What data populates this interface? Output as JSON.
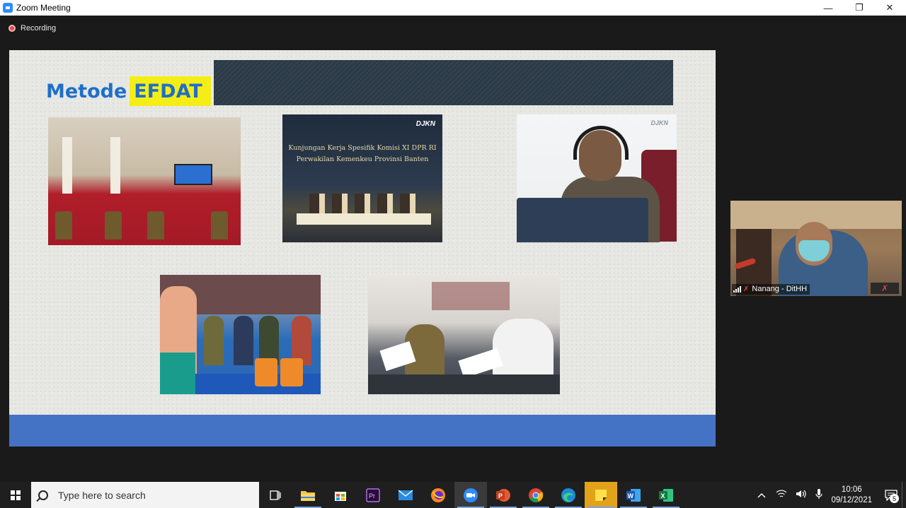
{
  "window": {
    "title": "Zoom Meeting",
    "minimize": "—",
    "maximize": "❐",
    "close": "✕"
  },
  "recording": {
    "label": "Recording"
  },
  "slide": {
    "title_part1": "Metode",
    "title_part2": "EFDAT",
    "photo2": {
      "brand": "DJKN",
      "caption_line1": "Kunjungan Kerja Spesifik Komisi XI DPR RI",
      "caption_line2": "Perwakilan Kemenkeu Provinsi Banten"
    },
    "photo3": {
      "brand": "DJKN"
    }
  },
  "participant": {
    "name": "Nanang - DitHH"
  },
  "taskbar": {
    "search_placeholder": "Type here to search",
    "apps": [
      "task-view",
      "file-explorer",
      "microsoft-store",
      "premiere-pro",
      "mail",
      "firefox",
      "zoom",
      "powerpoint",
      "chrome",
      "edge",
      "sticky-notes",
      "word",
      "excel"
    ],
    "time": "10:06",
    "date": "09/12/2021",
    "notifications": "5"
  },
  "colors": {
    "slide_title": "#1f6fc8",
    "title_highlight": "#f4ee16",
    "slide_footer": "#4472c4",
    "taskbar": "#1f1f1f"
  }
}
